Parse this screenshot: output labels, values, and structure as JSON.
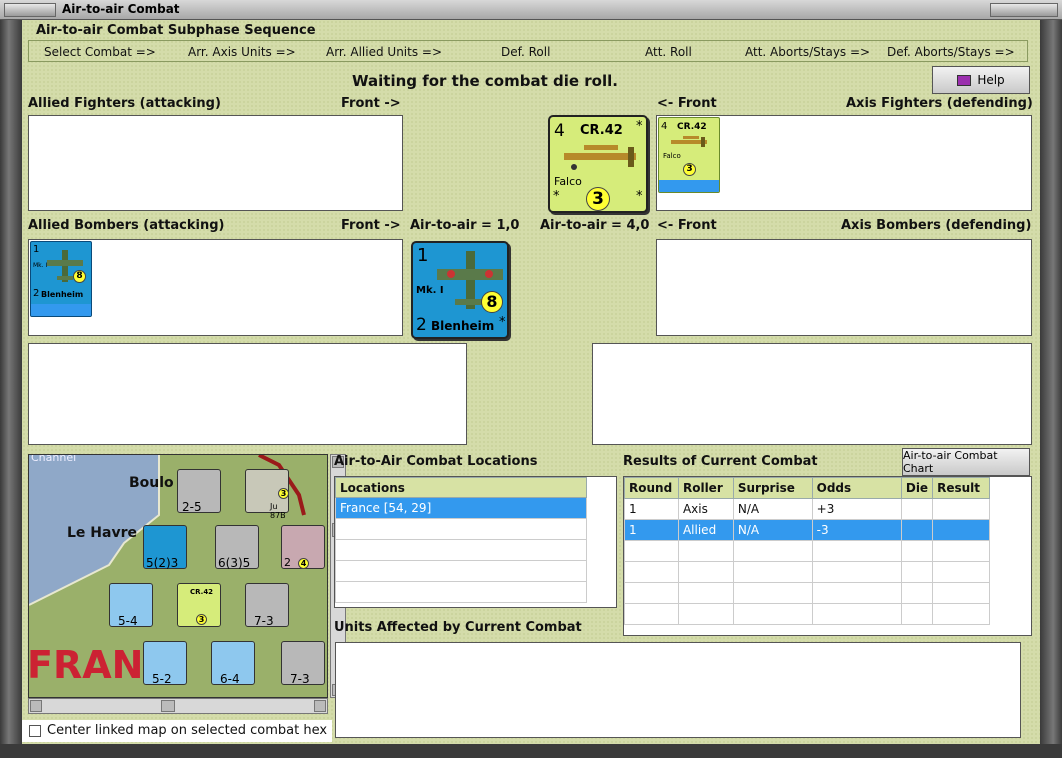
{
  "window": {
    "title": "Air-to-air Combat"
  },
  "sequence": {
    "heading": "Air-to-air Combat Subphase Sequence",
    "steps": [
      "Select Combat =>",
      "Arr. Axis Units =>",
      "Arr. Allied Units =>",
      "Def. Roll",
      "Att. Roll",
      "Att. Aborts/Stays =>",
      "Def. Aborts/Stays =>"
    ]
  },
  "status_message": "Waiting for the combat die roll.",
  "help_button": "Help",
  "sections": {
    "allied_fighters": "Allied Fighters (attacking)",
    "allied_front": "Front ->",
    "axis_front": "<- Front",
    "axis_fighters": "Axis Fighters (defending)",
    "allied_bombers": "Allied Bombers (attacking)",
    "allied_bombers_front": "Front ->",
    "allied_air_to_air": "Air-to-air = 1,0",
    "axis_air_to_air": "Air-to-air = 4,0",
    "axis_bombers_front": "<- Front",
    "axis_bombers": "Axis Bombers (defending)"
  },
  "axis_fighter_counter": {
    "attack": "4",
    "type": "CR.42",
    "name": "Falco",
    "value": "3",
    "corner": "*"
  },
  "allied_bomber_counter": {
    "attack": "1",
    "model": "Mk. I",
    "range": "2",
    "name": "Blenheim",
    "value": "8",
    "corner": "*"
  },
  "locations": {
    "title": "Air-to-Air Combat Locations",
    "header": "Locations",
    "rows": [
      "France [54, 29]"
    ]
  },
  "results": {
    "title": "Results of Current Combat",
    "chart_button": "Air-to-air Combat Chart",
    "columns": [
      "Round",
      "Roller",
      "Surprise",
      "Odds",
      "Die",
      "Result"
    ],
    "rows": [
      [
        "1",
        "Axis",
        "N/A",
        "+3",
        "",
        ""
      ],
      [
        "1",
        "Allied",
        "N/A",
        "-3",
        "",
        ""
      ]
    ]
  },
  "affected": {
    "title": "Units Affected by Current Combat"
  },
  "map": {
    "labels": {
      "channel": "Channel",
      "boulogne": "Boulo",
      "le_havre": "Le Havre",
      "france": "FRANC"
    },
    "units": [
      {
        "top": "xx",
        "value": "2-5"
      },
      {
        "top": "",
        "value": "Ju 87B"
      },
      {
        "top": "xxxxx",
        "value": "5(2)3"
      },
      {
        "top": "",
        "value": "6(3)5"
      },
      {
        "top": "xxx",
        "value": "5-4"
      },
      {
        "top": "",
        "value": "CR.42"
      },
      {
        "top": "",
        "value": "7-3"
      },
      {
        "top": "xxx",
        "value": "5-2"
      },
      {
        "top": "xxx",
        "value": "6-4"
      },
      {
        "top": "",
        "value": "7-3"
      }
    ],
    "stack_counts": [
      "3",
      "3",
      "4",
      "2",
      "3"
    ]
  },
  "center_checkbox": {
    "label": "Center linked map on selected combat hex",
    "checked": false
  },
  "colors": {
    "panel": "#d4dcaa",
    "selection": "#3399ee",
    "allied_counter": "#1e96d2",
    "axis_counter": "#d6ec7a"
  }
}
